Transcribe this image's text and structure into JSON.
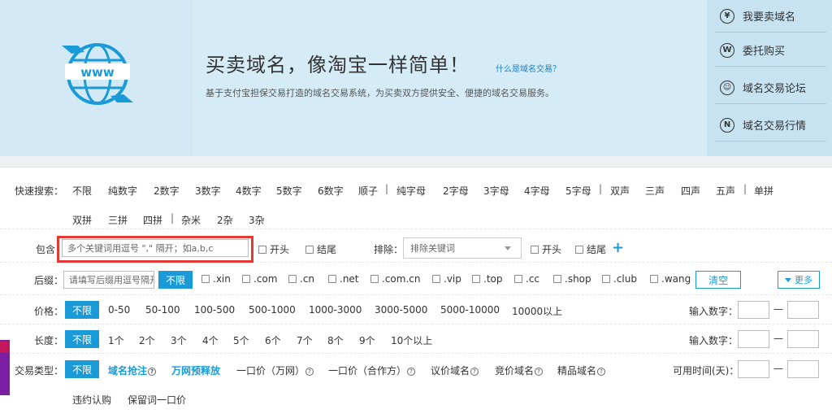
{
  "banner": {
    "title": "买卖域名，像淘宝一样简单！",
    "link": "什么是域名交易？",
    "subtitle": "基于支付宝担保交易打造的域名交易系统，为买卖双方提供安全、便捷的域名交易服务。",
    "logo_text": "www"
  },
  "side_menu": [
    {
      "icon": "yen-icon",
      "glyph": "¥",
      "label": "我要卖域名"
    },
    {
      "icon": "w-icon",
      "glyph": "W",
      "label": "委托购买"
    },
    {
      "icon": "user-icon",
      "glyph": "☺",
      "label": "域名交易论坛"
    },
    {
      "icon": "trend-icon",
      "glyph": "N",
      "label": "域名交易行情"
    }
  ],
  "quick": {
    "label": "快速搜索：",
    "row1": [
      "不限",
      "纯数字",
      "2数字",
      "3数字",
      "4数字",
      "5数字",
      "6数字",
      "顺子",
      "纯字母",
      "2字母",
      "3字母",
      "4字母",
      "5字母",
      "双声",
      "三声",
      "四声",
      "五声",
      "单拼"
    ],
    "row2": [
      "双拼",
      "三拼",
      "四拼",
      "杂米",
      "2杂",
      "3杂"
    ]
  },
  "contain": {
    "label": "包含",
    "placeholder": "多个关键词用逗号 \",\" 隔开；如a,b,c",
    "start": "开头",
    "end": "结尾",
    "exclude_label": "排除：",
    "exclude_placeholder": "排除关键词",
    "exclude_start": "开头",
    "exclude_end": "结尾",
    "plus": "+"
  },
  "suffix": {
    "label": "后缀：",
    "placeholder": "请填写后缀用逗号隔开",
    "all": "不限",
    "items": [
      ".xin",
      ".com",
      ".cn",
      ".net",
      ".com.cn",
      ".vip",
      ".top",
      ".cc",
      ".shop",
      ".club",
      ".wang"
    ],
    "clear": "清空",
    "more": "更多"
  },
  "price": {
    "label": "价格：",
    "all": "不限",
    "items": [
      "0-50",
      "50-100",
      "100-500",
      "500-1000",
      "1000-3000",
      "3000-5000",
      "5000-10000",
      "10000以上"
    ],
    "input_label": "输入数字：",
    "dash": "—"
  },
  "length": {
    "label": "长度：",
    "all": "不限",
    "items": [
      "1个",
      "2个",
      "3个",
      "4个",
      "5个",
      "6个",
      "7个",
      "8个",
      "9个",
      "10个以上"
    ],
    "input_label": "输入数字：",
    "dash": "—"
  },
  "trade": {
    "label": "交易类型：",
    "all": "不限",
    "hot": [
      "域名抢注",
      "万网预释放"
    ],
    "items": [
      "一口价（万网）",
      "一口价（合作方）",
      "议价域名",
      "竞价域名",
      "精品域名"
    ],
    "row2": [
      "违约认购",
      "保留词一口价"
    ],
    "time_label": "可用时间(天)：",
    "dash": "—"
  },
  "colors": {
    "accent": "#1a9bd7",
    "banner": "#d5ebf6",
    "highlight": "#e53935"
  }
}
